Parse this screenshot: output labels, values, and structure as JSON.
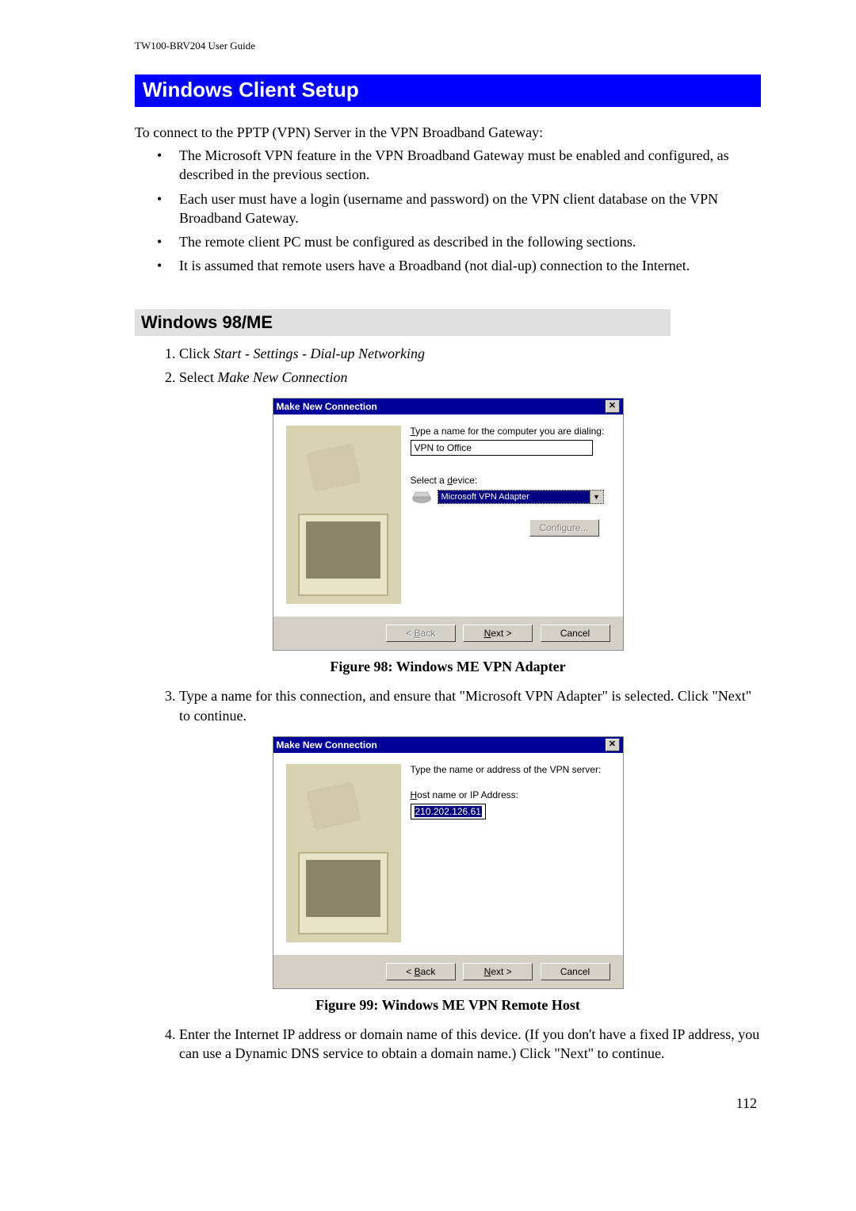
{
  "doc": {
    "header": "TW100-BRV204  User Guide",
    "page_number": "112"
  },
  "headings": {
    "main": "Windows Client Setup",
    "sub": "Windows 98/ME"
  },
  "intro": "To connect to the PPTP (VPN) Server in the VPN Broadband Gateway:",
  "bullets": [
    "The Microsoft VPN feature in the VPN Broadband Gateway must be enabled and configured, as described in the previous section.",
    "Each user must have a login (username and password) on the VPN client database on the VPN Broadband Gateway.",
    "The remote client PC must be configured as described in the following sections.",
    "It is assumed that remote users have a Broadband (not dial-up) connection to the Internet."
  ],
  "steps": {
    "s1_prefix": "Click ",
    "s1_italic": "Start - Settings - Dial-up Networking",
    "s2_prefix": "Select ",
    "s2_italic": "Make New Connection",
    "s3": "Type a name for this connection, and ensure that \"Microsoft VPN Adapter\" is selected. Click \"Next\" to continue.",
    "s4": "Enter the Internet IP address or domain name of this device. (If you don't have a fixed IP address, you can use a Dynamic DNS service to obtain a domain name.) Click \"Next\" to continue."
  },
  "dialog1": {
    "title": "Make New Connection",
    "label1_pre": "T",
    "label1_rest": "ype a name for the computer you are dialing:",
    "name_value": "VPN to Office",
    "label2_pre": "Select a ",
    "label2_ul": "d",
    "label2_post": "evice:",
    "device_value": "Microsoft VPN Adapter",
    "btn_configure": "Configure...",
    "btn_back_pre": "< ",
    "btn_back_ul": "B",
    "btn_back_post": "ack",
    "btn_next_ul": "N",
    "btn_next_post": "ext >",
    "btn_cancel": "Cancel"
  },
  "dialog2": {
    "title": "Make New Connection",
    "label1": "Type the name or address of the VPN server:",
    "label2_ul": "H",
    "label2_post": "ost name or IP Address:",
    "addr_value": "210.202.126.61",
    "btn_back_pre": "< ",
    "btn_back_ul": "B",
    "btn_back_post": "ack",
    "btn_next_ul": "N",
    "btn_next_post": "ext >",
    "btn_cancel": "Cancel"
  },
  "captions": {
    "fig98": "Figure 98: Windows ME VPN Adapter",
    "fig99": "Figure 99: Windows ME VPN Remote Host"
  }
}
